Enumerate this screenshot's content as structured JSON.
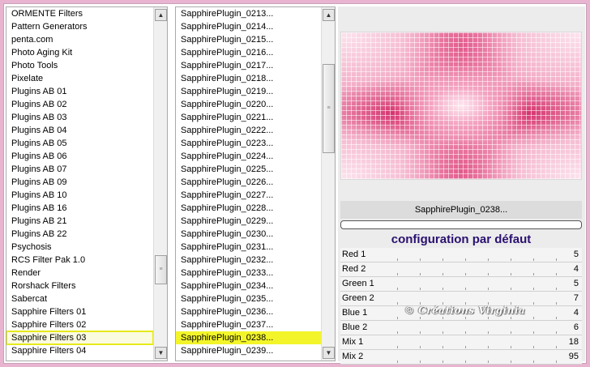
{
  "categories": {
    "items": [
      "ORMENTE Filters",
      "Pattern Generators",
      "penta.com",
      "Photo Aging Kit",
      "Photo Tools",
      "Pixelate",
      "Plugins AB 01",
      "Plugins AB 02",
      "Plugins AB 03",
      "Plugins AB 04",
      "Plugins AB 05",
      "Plugins AB 06",
      "Plugins AB 07",
      "Plugins AB 09",
      "Plugins AB 10",
      "Plugins AB 16",
      "Plugins AB 21",
      "Plugins AB 22",
      "Psychosis",
      "RCS Filter Pak 1.0",
      "Render",
      "Rorshack Filters",
      "Sabercat",
      "Sapphire Filters 01",
      "Sapphire Filters 02",
      "Sapphire Filters 03",
      "Sapphire Filters 04"
    ],
    "selected": "Sapphire Filters 03"
  },
  "filters": {
    "items": [
      "SapphirePlugin_0213...",
      "SapphirePlugin_0214...",
      "SapphirePlugin_0215...",
      "SapphirePlugin_0216...",
      "SapphirePlugin_0217...",
      "SapphirePlugin_0218...",
      "SapphirePlugin_0219...",
      "SapphirePlugin_0220...",
      "SapphirePlugin_0221...",
      "SapphirePlugin_0222...",
      "SapphirePlugin_0223...",
      "SapphirePlugin_0224...",
      "SapphirePlugin_0225...",
      "SapphirePlugin_0226...",
      "SapphirePlugin_0227...",
      "SapphirePlugin_0228...",
      "SapphirePlugin_0229...",
      "SapphirePlugin_0230...",
      "SapphirePlugin_0231...",
      "SapphirePlugin_0232...",
      "SapphirePlugin_0233...",
      "SapphirePlugin_0234...",
      "SapphirePlugin_0235...",
      "SapphirePlugin_0236...",
      "SapphirePlugin_0237...",
      "SapphirePlugin_0238...",
      "SapphirePlugin_0239..."
    ],
    "selected": "SapphirePlugin_0238..."
  },
  "preview": {
    "filter_name": "SapphirePlugin_0238...",
    "config_title": "configuration par défaut"
  },
  "params": [
    {
      "label": "Red 1",
      "value": "5"
    },
    {
      "label": "Red 2",
      "value": "4"
    },
    {
      "label": "Green 1",
      "value": "5"
    },
    {
      "label": "Green 2",
      "value": "7"
    },
    {
      "label": "Blue 1",
      "value": "4"
    },
    {
      "label": "Blue 2",
      "value": "6"
    },
    {
      "label": "Mix 1",
      "value": "18"
    },
    {
      "label": "Mix 2",
      "value": "95"
    }
  ],
  "watermark": "© Créations Virginia",
  "colors": {
    "background": "#e8b4cf",
    "highlight": "#f3f52a",
    "config_title": "#2a1070"
  },
  "icons": {
    "scroll_up": "chevron-up-icon",
    "scroll_down": "chevron-down-icon",
    "thumb_grip": "grip-icon"
  }
}
